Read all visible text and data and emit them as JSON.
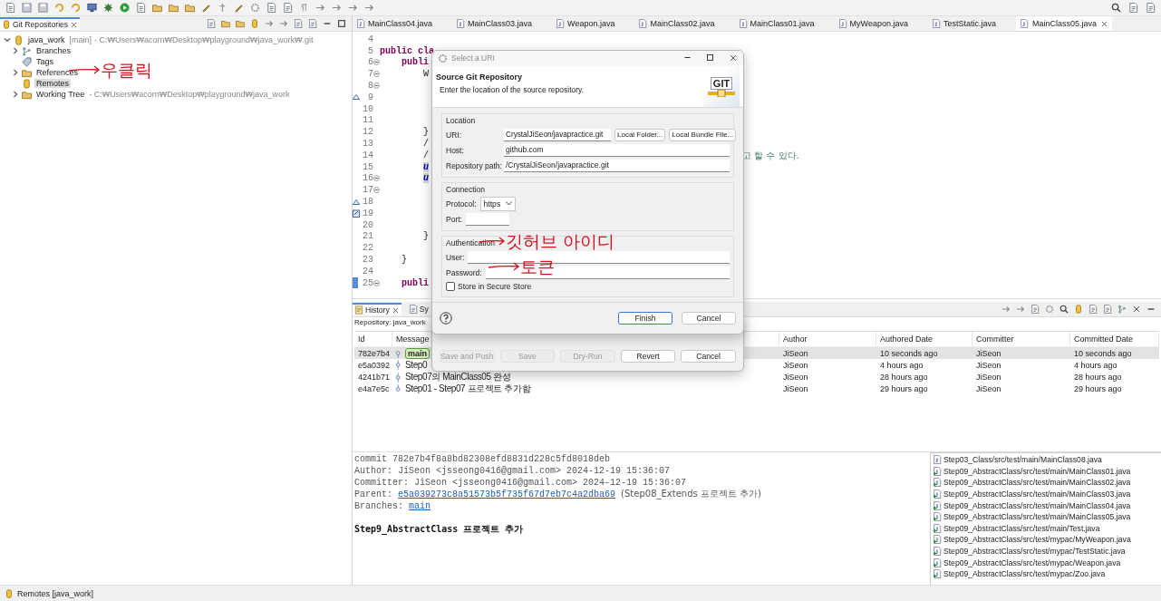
{
  "git_repositories": {
    "tab": {
      "label": "Git Repositories",
      "selected": true
    },
    "tree": [
      {
        "label": "java_work",
        "branch": "[main]",
        "path": "- C:₩Users₩acorn₩Desktop₩playground₩java_work₩.git",
        "kind": "repo",
        "expanded": true,
        "selected": false,
        "children": [
          {
            "label": "Branches",
            "kind": "branches",
            "expanded": false,
            "selected": false
          },
          {
            "label": "Tags",
            "kind": "tags",
            "selected": false
          },
          {
            "label": "References",
            "kind": "folder",
            "expanded": false,
            "selected": false
          },
          {
            "label": "Remotes",
            "kind": "repo",
            "selected": true
          },
          {
            "label": "Working Tree",
            "path": "- C:₩Users₩acorn₩Desktop₩playground₩java_work",
            "kind": "folder",
            "expanded": false,
            "selected": false
          }
        ]
      }
    ]
  },
  "editor": {
    "tabs": [
      {
        "label": "MainClass04.java",
        "selected": false
      },
      {
        "label": "MainClass03.java",
        "selected": false
      },
      {
        "label": "Weapon.java",
        "selected": false
      },
      {
        "label": "MainClass02.java",
        "selected": false
      },
      {
        "label": "MainClass01.java",
        "selected": false
      },
      {
        "label": "MyWeapon.java",
        "selected": false
      },
      {
        "label": "TestStatic.java",
        "selected": false
      },
      {
        "label": "MainClass05.java",
        "selected": true
      }
    ],
    "lines": [
      {
        "number": "4",
        "fold": false,
        "override": false,
        "task": false,
        "current": false
      },
      {
        "number": "5",
        "text": "public cla",
        "kind": "keyword",
        "fold": false,
        "override": false,
        "task": false,
        "current": false
      },
      {
        "number": "6",
        "text": "    publi",
        "kind": "keyword",
        "fold": true,
        "override": false,
        "task": false,
        "current": false
      },
      {
        "number": "7",
        "text": "        W",
        "kind": "plain",
        "fold": true,
        "override": false,
        "task": false,
        "current": false
      },
      {
        "number": "8",
        "fold": true,
        "override": false,
        "task": false,
        "current": false
      },
      {
        "number": "9",
        "fold": false,
        "override": true,
        "task": false,
        "current": false
      },
      {
        "number": "10",
        "fold": false,
        "override": false,
        "task": false,
        "current": false
      },
      {
        "number": "11",
        "fold": false,
        "override": false,
        "task": false,
        "current": false
      },
      {
        "number": "12",
        "text": "        }",
        "kind": "plain",
        "fold": false,
        "override": false,
        "task": false,
        "current": false
      },
      {
        "number": "13",
        "text": "        /",
        "kind": "plain",
        "fold": false,
        "override": false,
        "task": false,
        "current": false
      },
      {
        "number": "14",
        "text": "        /",
        "kind": "plain",
        "tail": "고 할 수 있다.",
        "fold": false,
        "override": false,
        "task": false,
        "current": false
      },
      {
        "number": "15",
        "text": "        u",
        "kind": "highlight",
        "fold": false,
        "override": false,
        "task": false,
        "current": false
      },
      {
        "number": "16",
        "text": "        u",
        "kind": "highlight",
        "fold": true,
        "override": false,
        "task": false,
        "current": false
      },
      {
        "number": "17",
        "fold": true,
        "override": false,
        "task": false,
        "current": false
      },
      {
        "number": "18",
        "fold": false,
        "override": true,
        "task": false,
        "current": false
      },
      {
        "number": "19",
        "fold": false,
        "override": false,
        "task": true,
        "current": false
      },
      {
        "number": "20",
        "fold": false,
        "override": false,
        "task": false,
        "current": false
      },
      {
        "number": "21",
        "text": "        }",
        "kind": "plain",
        "fold": false,
        "override": false,
        "task": false,
        "current": false
      },
      {
        "number": "22",
        "fold": false,
        "override": false,
        "task": false,
        "current": false
      },
      {
        "number": "23",
        "text": "    }",
        "kind": "plain",
        "fold": false,
        "override": false,
        "task": false,
        "current": false
      },
      {
        "number": "24",
        "fold": false,
        "override": false,
        "task": false,
        "current": false
      },
      {
        "number": "25",
        "text": "    publi",
        "kind": "keyword",
        "fold": true,
        "override": false,
        "task": false,
        "current": true
      }
    ]
  },
  "history": {
    "tabs": [
      {
        "label": "History",
        "selected": true
      },
      {
        "label": "Sy",
        "selected": false
      }
    ],
    "repository": "Repository: java_work",
    "columns": [
      "Id",
      "Message",
      "Author",
      "Authored Date",
      "Committer",
      "Committed Date"
    ],
    "rows": [
      {
        "id": "782e7b4",
        "ref": "main",
        "author": "JiSeon",
        "authored": "10 seconds ago",
        "committer": "JiSeon",
        "committed": "10 seconds ago",
        "selected": true
      },
      {
        "id": "e5a0392",
        "message": "Step0",
        "author": "JiSeon",
        "authored": "4 hours ago",
        "committer": "JiSeon",
        "committed": "4 hours ago",
        "selected": false
      },
      {
        "id": "4241b71",
        "message": "Step07의 MainClass05 완성",
        "author": "JiSeon",
        "authored": "28 hours ago",
        "committer": "JiSeon",
        "committed": "28 hours ago",
        "selected": false
      },
      {
        "id": "e4a7e5c",
        "message": "Step01 - Step07 프로젝트 추가함",
        "author": "JiSeon",
        "authored": "29 hours ago",
        "committer": "JiSeon",
        "committed": "29 hours ago",
        "selected": false
      }
    ],
    "details": {
      "commit": "commit 782e7b4f8a8bd82308efd8831d228c5fd8018deb",
      "author": "Author: JiSeon <jsseong0416@gmail.com> 2024-12-19 15:36:07",
      "committer": "Committer: JiSeon <jsseong0416@gmail.com> 2024-12-19 15:36:07",
      "parent_label": "Parent:",
      "parent_link": "e5a039273c8a51573b5f735f67d7eb7c4a2dba69",
      "parent_note": "(Step08_Extends 프로젝트 추가)",
      "branches_label": "Branches:",
      "branches_link": "main",
      "message": "Step9_AbstractClass 프로젝트 추가"
    },
    "files": [
      {
        "path": "Step03_Class/src/test/main/MainClass08.java",
        "kind": "plain"
      },
      {
        "path": "Step09_AbstractClass/src/test/main/MainClass01.java",
        "kind": "added"
      },
      {
        "path": "Step09_AbstractClass/src/test/main/MainClass02.java",
        "kind": "added"
      },
      {
        "path": "Step09_AbstractClass/src/test/main/MainClass03.java",
        "kind": "added"
      },
      {
        "path": "Step09_AbstractClass/src/test/main/MainClass04.java",
        "kind": "added"
      },
      {
        "path": "Step09_AbstractClass/src/test/main/MainClass05.java",
        "kind": "added"
      },
      {
        "path": "Step09_AbstractClass/src/test/main/Test.java",
        "kind": "added"
      },
      {
        "path": "Step09_AbstractClass/src/test/mypac/MyWeapon.java",
        "kind": "added"
      },
      {
        "path": "Step09_AbstractClass/src/test/mypac/TestStatic.java",
        "kind": "added"
      },
      {
        "path": "Step09_AbstractClass/src/test/mypac/Weapon.java",
        "kind": "added"
      },
      {
        "path": "Step09_AbstractClass/src/test/mypac/Zoo.java",
        "kind": "added"
      }
    ]
  },
  "commit_dialog": {
    "buttons": [
      {
        "label": "Save and Push",
        "disabled": true
      },
      {
        "label": "Save",
        "disabled": true
      },
      {
        "label": "Dry-Run",
        "disabled": true
      },
      {
        "label": "Revert",
        "disabled": false
      },
      {
        "label": "Cancel",
        "disabled": false
      }
    ]
  },
  "uri_dialog": {
    "title": "Select a URI",
    "heading": "Source Git Repository",
    "description": "Enter the location of the source repository.",
    "logo": "GIT",
    "location": {
      "title": "Location",
      "uri_label": "URI:",
      "uri": "CrystalJiSeon/javapractice.git",
      "local_folder": "Local Folder...",
      "local_bundle": "Local Bundle File...",
      "host_label": "Host:",
      "host": "github.com",
      "path_label": "Repository path:",
      "path": "/CrystalJiSeon/javapractice.git"
    },
    "connection": {
      "title": "Connection",
      "protocol_label": "Protocol:",
      "protocol": "https",
      "port_label": "Port:"
    },
    "authentication": {
      "title": "Authentication",
      "user_label": "User:",
      "password_label": "Password:",
      "store_label": "Store in Secure Store",
      "store_checked": false
    },
    "buttons": [
      {
        "label": "Finish",
        "default": true
      },
      {
        "label": "Cancel",
        "default": false
      }
    ]
  },
  "annotations": [
    {
      "text": "우클릭"
    },
    {
      "text": "깃허브 아이디"
    },
    {
      "text": "토큰"
    }
  ],
  "status_bar": {
    "text": "Remotes [java_work]"
  }
}
